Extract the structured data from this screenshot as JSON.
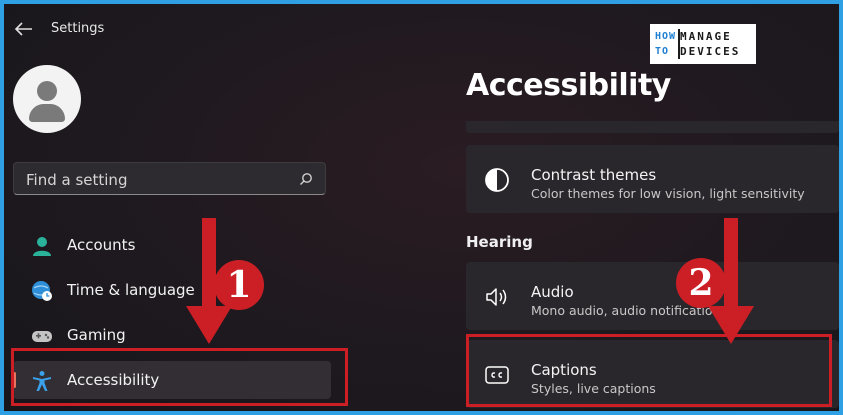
{
  "window": {
    "title": "Settings"
  },
  "logo": {
    "line1_left": "HOW",
    "line2_left": "TO",
    "line1_right": "MANAGE",
    "line2_right": "DEVICES"
  },
  "search": {
    "placeholder": "Find a setting"
  },
  "sidebar": {
    "items": [
      {
        "label": "Accounts",
        "icon": "accounts-icon"
      },
      {
        "label": "Time & language",
        "icon": "globe-clock-icon"
      },
      {
        "label": "Gaming",
        "icon": "gamepad-icon"
      },
      {
        "label": "Accessibility",
        "icon": "accessibility-icon",
        "active": true
      }
    ]
  },
  "main": {
    "title": "Accessibility",
    "cards": [
      {
        "title": "Contrast themes",
        "subtitle": "Color themes for low vision, light sensitivity",
        "icon": "contrast-icon"
      },
      {
        "title": "Audio",
        "subtitle": "Mono audio, audio notifications",
        "icon": "speaker-icon"
      },
      {
        "title": "Captions",
        "subtitle": "Styles, live captions",
        "icon": "captions-icon"
      }
    ],
    "section_hearing": "Hearing"
  },
  "annotations": {
    "step1": "1",
    "step2": "2",
    "color": "#cc1f25"
  },
  "colors": {
    "accent": "#e8735f",
    "highlight": "#cc1f25"
  }
}
